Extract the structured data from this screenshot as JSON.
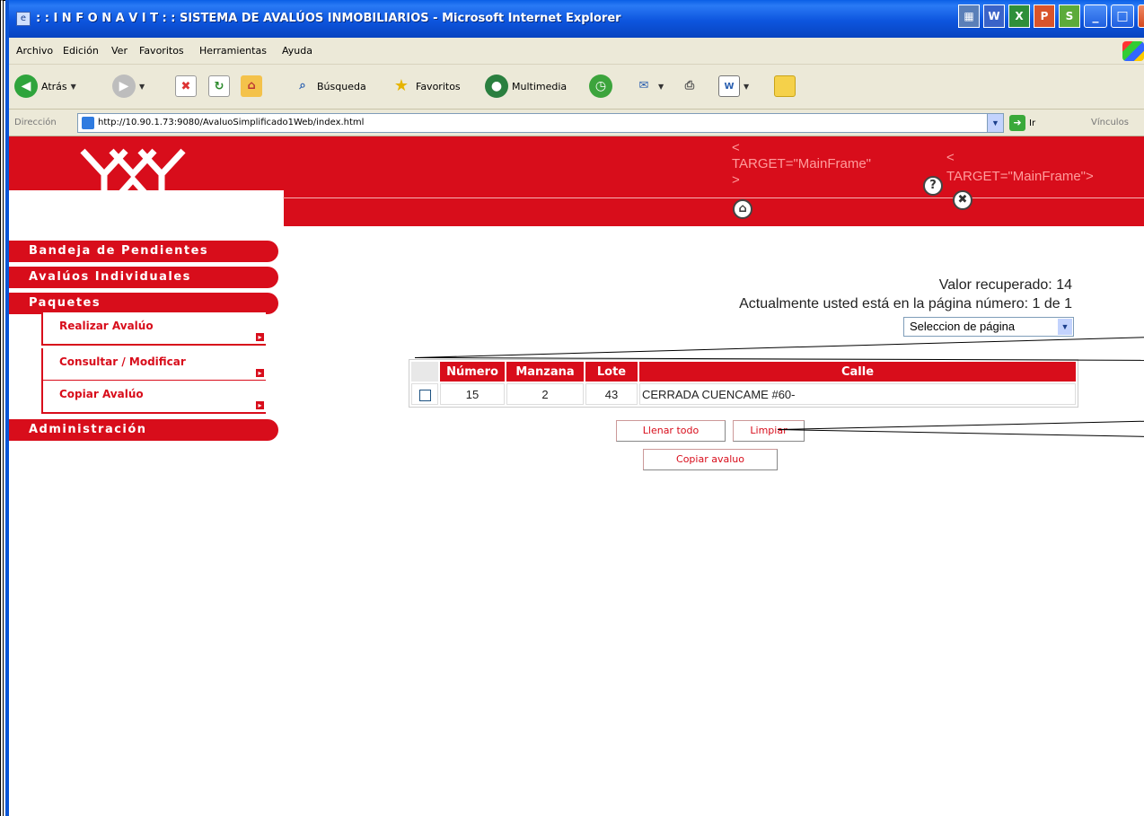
{
  "window": {
    "title": ": : I N F O N A V I T : : SISTEMA DE AVALÚOS INMOBILIARIOS - Microsoft Internet Explorer",
    "title_icon": "ie-page-icon",
    "tray_icons": [
      "W",
      "X",
      "P",
      "S"
    ],
    "controls": {
      "minimize": "_",
      "maximize": "□",
      "close": "X"
    }
  },
  "menubar": {
    "items": [
      "Archivo",
      "Edición",
      "Ver",
      "Favoritos",
      "Herramientas",
      "Ayuda"
    ]
  },
  "toolbar": {
    "back": "Atrás",
    "search": "Búsqueda",
    "favorites": "Favoritos",
    "media": "Multimedia"
  },
  "address": {
    "label": "Dirección",
    "url": "http://10.90.1.73:9080/AvaluoSimplificado1Web/index.html",
    "go": "Ir",
    "links": "Vínculos"
  },
  "header": {
    "logo_text": "INFONAVIT",
    "target1_a": "<",
    "target1_b": "TARGET=\"MainFrame\"",
    "target1_c": ">",
    "target2_a": "<",
    "target2_b": "TARGET=\"MainFrame\">",
    "help_icon": "?",
    "close_icon": "✖",
    "home_icon": "⌂"
  },
  "sidebar": {
    "items": [
      {
        "label": "Bandeja de Pendientes"
      },
      {
        "label": "Avalúos Individuales"
      },
      {
        "label": "Paquetes"
      }
    ],
    "sub_items": [
      {
        "label": "Realizar Avalúo"
      },
      {
        "label": "Consultar / Modificar"
      },
      {
        "label": "Copiar Avalúo"
      }
    ],
    "admin": "Administración"
  },
  "content": {
    "valor": "Valor recuperado: 14",
    "pagina": "Actualmente usted está en la página número: 1 de 1",
    "page_select": "Seleccion de página",
    "table": {
      "headers": [
        "Número",
        "Manzana",
        "Lote",
        "Calle"
      ],
      "rows": [
        {
          "numero": "15",
          "manzana": "2",
          "lote": "43",
          "calle": "CERRADA CUENCAME #60-"
        }
      ]
    },
    "buttons": {
      "llenar": "Llenar todo",
      "limpiar": "Limpiar",
      "copiar": "Copiar avaluo"
    }
  },
  "colors": {
    "brand_red": "#d80d1b",
    "xp_blue": "#0a55d6"
  }
}
